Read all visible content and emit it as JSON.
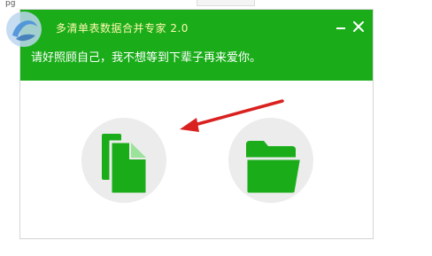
{
  "background": {
    "left_fragment": "pg",
    "box_fragment": ""
  },
  "window": {
    "title": "多清单表数据合并专家 2.0",
    "tagline": "请好照顾自己，我不想等到下辈子再来爱你。",
    "minimize_label": "",
    "close_label": ""
  },
  "actions": {
    "files_label": "",
    "folder_label": ""
  },
  "colors": {
    "header_green": "#1aad19",
    "icon_green": "#1aad19",
    "card_gray": "#ececec",
    "title_yellow": "#fff7b0",
    "arrow_red": "#d9211f"
  },
  "icons": {
    "watermark": "logo-watermark-icon",
    "files": "files-icon",
    "folder": "folder-open-icon",
    "minimize": "minimize-icon",
    "close": "close-icon"
  }
}
